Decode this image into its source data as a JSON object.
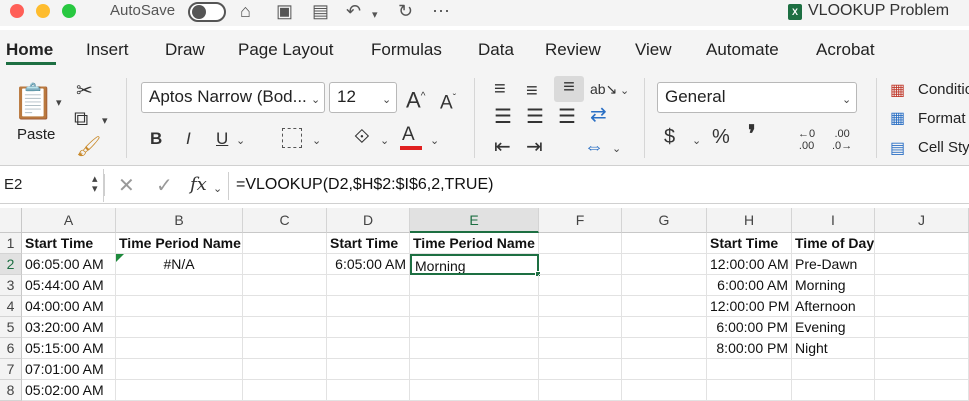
{
  "titlebar": {
    "autosave_label": "AutoSave",
    "doc_title": "VLOOKUP Problem",
    "window_colors": [
      "#ff5f57",
      "#febc2e",
      "#28c840"
    ]
  },
  "tabs": [
    "Home",
    "Insert",
    "Draw",
    "Page Layout",
    "Formulas",
    "Data",
    "Review",
    "View",
    "Automate",
    "Acrobat"
  ],
  "active_tab": "Home",
  "ribbon": {
    "paste_label": "Paste",
    "font_name": "Aptos Narrow (Bod...",
    "font_size": "12",
    "bold": "B",
    "italic": "I",
    "underline": "U",
    "number_format": "General",
    "currency": "$",
    "percent": "%",
    "comma": "❜",
    "increase_decimal": ".00",
    "decrease_decimal": ".0",
    "conditional": "Conditio",
    "format_as": "Format",
    "cell_styles": "Cell Sty"
  },
  "formula_bar": {
    "name_box": "E2",
    "fx": "fx",
    "formula": "=VLOOKUP(D2,$H$2:$I$6,2,TRUE)"
  },
  "columns": [
    "A",
    "B",
    "C",
    "D",
    "E",
    "F",
    "G",
    "H",
    "I",
    "J"
  ],
  "rows": [
    "1",
    "2",
    "3",
    "4",
    "5",
    "6",
    "7",
    "8"
  ],
  "cells": {
    "A1": "Start Time",
    "B1": "Time Period Name",
    "D1": "Start Time",
    "E1": "Time Period Name",
    "H1": "Start Time",
    "I1": "Time of Day",
    "A2": "06:05:00 AM",
    "B2": "#N/A",
    "D2": "6:05:00 AM",
    "E2": "Morning",
    "H2": "12:00:00 AM",
    "I2": "Pre-Dawn",
    "A3": "05:44:00 AM",
    "H3": "6:00:00 AM",
    "I3": "Morning",
    "A4": "04:00:00 AM",
    "H4": "12:00:00 PM",
    "I4": "Afternoon",
    "A5": "03:20:00 AM",
    "H5": "6:00:00 PM",
    "I5": "Evening",
    "A6": "05:15:00 AM",
    "H6": "8:00:00 PM",
    "I6": "Night",
    "A7": "07:01:00 AM",
    "A8": "05:02:00 AM"
  },
  "accent_color": "#1d6f42"
}
